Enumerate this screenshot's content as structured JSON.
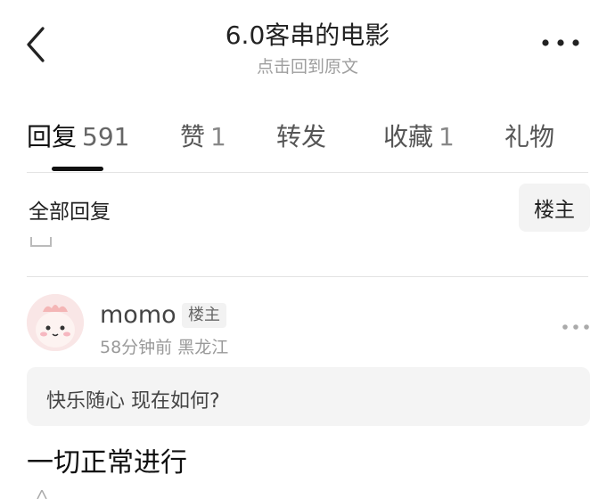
{
  "header": {
    "title": "6.0客串的电影",
    "subtitle": "点击回到原文",
    "back_icon": "chevron-left-icon",
    "more_icon": "more-horizontal-icon"
  },
  "tabs": [
    {
      "label": "回复",
      "count": "591",
      "active": true
    },
    {
      "label": "赞",
      "count": "1"
    },
    {
      "label": "转发",
      "count": ""
    },
    {
      "label": "收藏",
      "count": "1"
    },
    {
      "label": "礼物",
      "count": ""
    }
  ],
  "filter": {
    "all_replies": "全部回复",
    "op_only": "楼主"
  },
  "post": {
    "username": "momo",
    "badge": "楼主",
    "time": "58分钟前",
    "location": "黑龙江",
    "quote": "快乐随心 现在如何?",
    "reply": "一切正常进行"
  },
  "colors": {
    "accent": "#111111",
    "muted": "#999999",
    "panel": "#f4f4f4",
    "avatar_bg": "#f9e6e6"
  }
}
